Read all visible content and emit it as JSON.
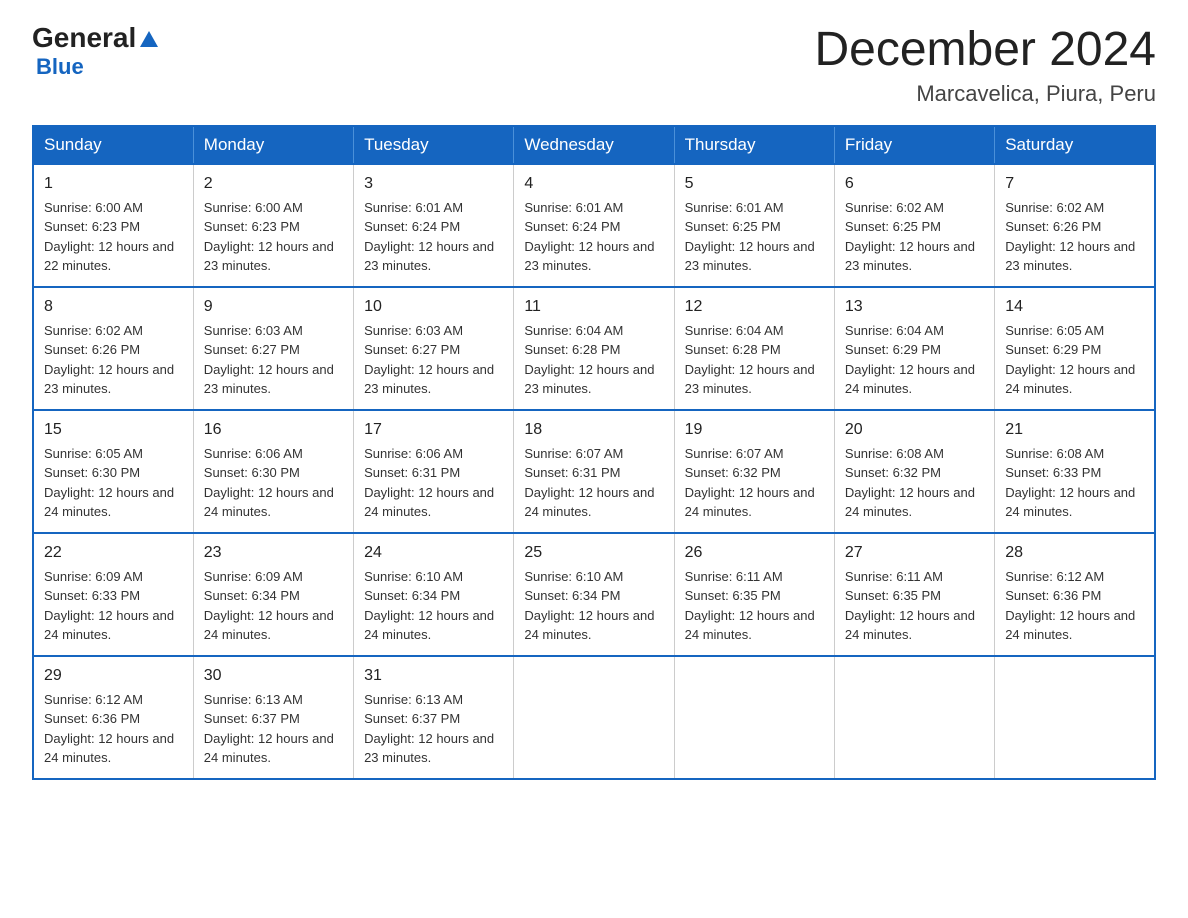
{
  "header": {
    "logo_general": "General",
    "logo_blue": "Blue",
    "month_title": "December 2024",
    "location": "Marcavelica, Piura, Peru"
  },
  "weekdays": [
    "Sunday",
    "Monday",
    "Tuesday",
    "Wednesday",
    "Thursday",
    "Friday",
    "Saturday"
  ],
  "weeks": [
    [
      {
        "day": 1,
        "sunrise": "6:00 AM",
        "sunset": "6:23 PM",
        "daylight": "12 hours and 22 minutes"
      },
      {
        "day": 2,
        "sunrise": "6:00 AM",
        "sunset": "6:23 PM",
        "daylight": "12 hours and 23 minutes"
      },
      {
        "day": 3,
        "sunrise": "6:01 AM",
        "sunset": "6:24 PM",
        "daylight": "12 hours and 23 minutes"
      },
      {
        "day": 4,
        "sunrise": "6:01 AM",
        "sunset": "6:24 PM",
        "daylight": "12 hours and 23 minutes"
      },
      {
        "day": 5,
        "sunrise": "6:01 AM",
        "sunset": "6:25 PM",
        "daylight": "12 hours and 23 minutes"
      },
      {
        "day": 6,
        "sunrise": "6:02 AM",
        "sunset": "6:25 PM",
        "daylight": "12 hours and 23 minutes"
      },
      {
        "day": 7,
        "sunrise": "6:02 AM",
        "sunset": "6:26 PM",
        "daylight": "12 hours and 23 minutes"
      }
    ],
    [
      {
        "day": 8,
        "sunrise": "6:02 AM",
        "sunset": "6:26 PM",
        "daylight": "12 hours and 23 minutes"
      },
      {
        "day": 9,
        "sunrise": "6:03 AM",
        "sunset": "6:27 PM",
        "daylight": "12 hours and 23 minutes"
      },
      {
        "day": 10,
        "sunrise": "6:03 AM",
        "sunset": "6:27 PM",
        "daylight": "12 hours and 23 minutes"
      },
      {
        "day": 11,
        "sunrise": "6:04 AM",
        "sunset": "6:28 PM",
        "daylight": "12 hours and 23 minutes"
      },
      {
        "day": 12,
        "sunrise": "6:04 AM",
        "sunset": "6:28 PM",
        "daylight": "12 hours and 23 minutes"
      },
      {
        "day": 13,
        "sunrise": "6:04 AM",
        "sunset": "6:29 PM",
        "daylight": "12 hours and 24 minutes"
      },
      {
        "day": 14,
        "sunrise": "6:05 AM",
        "sunset": "6:29 PM",
        "daylight": "12 hours and 24 minutes"
      }
    ],
    [
      {
        "day": 15,
        "sunrise": "6:05 AM",
        "sunset": "6:30 PM",
        "daylight": "12 hours and 24 minutes"
      },
      {
        "day": 16,
        "sunrise": "6:06 AM",
        "sunset": "6:30 PM",
        "daylight": "12 hours and 24 minutes"
      },
      {
        "day": 17,
        "sunrise": "6:06 AM",
        "sunset": "6:31 PM",
        "daylight": "12 hours and 24 minutes"
      },
      {
        "day": 18,
        "sunrise": "6:07 AM",
        "sunset": "6:31 PM",
        "daylight": "12 hours and 24 minutes"
      },
      {
        "day": 19,
        "sunrise": "6:07 AM",
        "sunset": "6:32 PM",
        "daylight": "12 hours and 24 minutes"
      },
      {
        "day": 20,
        "sunrise": "6:08 AM",
        "sunset": "6:32 PM",
        "daylight": "12 hours and 24 minutes"
      },
      {
        "day": 21,
        "sunrise": "6:08 AM",
        "sunset": "6:33 PM",
        "daylight": "12 hours and 24 minutes"
      }
    ],
    [
      {
        "day": 22,
        "sunrise": "6:09 AM",
        "sunset": "6:33 PM",
        "daylight": "12 hours and 24 minutes"
      },
      {
        "day": 23,
        "sunrise": "6:09 AM",
        "sunset": "6:34 PM",
        "daylight": "12 hours and 24 minutes"
      },
      {
        "day": 24,
        "sunrise": "6:10 AM",
        "sunset": "6:34 PM",
        "daylight": "12 hours and 24 minutes"
      },
      {
        "day": 25,
        "sunrise": "6:10 AM",
        "sunset": "6:34 PM",
        "daylight": "12 hours and 24 minutes"
      },
      {
        "day": 26,
        "sunrise": "6:11 AM",
        "sunset": "6:35 PM",
        "daylight": "12 hours and 24 minutes"
      },
      {
        "day": 27,
        "sunrise": "6:11 AM",
        "sunset": "6:35 PM",
        "daylight": "12 hours and 24 minutes"
      },
      {
        "day": 28,
        "sunrise": "6:12 AM",
        "sunset": "6:36 PM",
        "daylight": "12 hours and 24 minutes"
      }
    ],
    [
      {
        "day": 29,
        "sunrise": "6:12 AM",
        "sunset": "6:36 PM",
        "daylight": "12 hours and 24 minutes"
      },
      {
        "day": 30,
        "sunrise": "6:13 AM",
        "sunset": "6:37 PM",
        "daylight": "12 hours and 24 minutes"
      },
      {
        "day": 31,
        "sunrise": "6:13 AM",
        "sunset": "6:37 PM",
        "daylight": "12 hours and 23 minutes"
      },
      null,
      null,
      null,
      null
    ]
  ]
}
